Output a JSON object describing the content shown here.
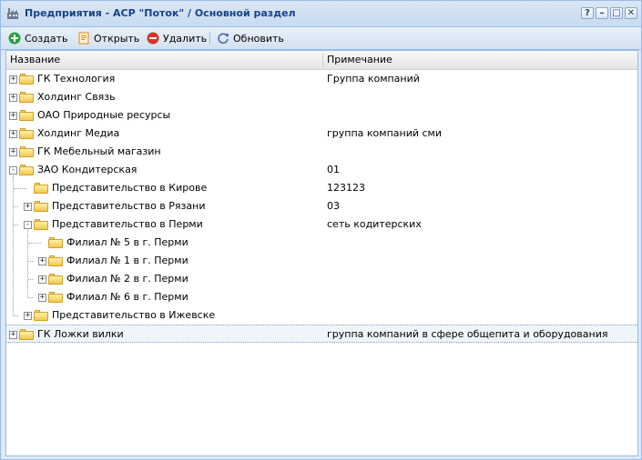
{
  "window": {
    "title": "Предприятия - АСР \"Поток\" / Основной раздел",
    "tools": {
      "help": "?",
      "minimize": "–",
      "maximize": "□",
      "close": "✕"
    }
  },
  "toolbar": {
    "create": "Создать",
    "open": "Открыть",
    "delete": "Удалить",
    "refresh": "Обновить"
  },
  "grid": {
    "columns": {
      "name": "Название",
      "note": "Примечание"
    },
    "rows": [
      {
        "name": "ГК Технология",
        "note": "Группа компаний",
        "level": 0,
        "expander": "+",
        "open": false
      },
      {
        "name": "Холдинг Связь",
        "note": "",
        "level": 0,
        "expander": "+",
        "open": false
      },
      {
        "name": "ОАО Природные ресурсы",
        "note": "",
        "level": 0,
        "expander": "+",
        "open": false
      },
      {
        "name": "Холдинг Медиа",
        "note": "группа компаний сми",
        "level": 0,
        "expander": "+",
        "open": false
      },
      {
        "name": "ГК Мебельный магазин",
        "note": "",
        "level": 0,
        "expander": "+",
        "open": false
      },
      {
        "name": "ЗАО Кондитерская",
        "note": "01",
        "level": 0,
        "expander": "-",
        "open": true
      },
      {
        "name": "Представительство в Кирове",
        "note": "123123",
        "level": 1,
        "expander": "",
        "open": false
      },
      {
        "name": "Представительство в Рязани",
        "note": "03",
        "level": 1,
        "expander": "+",
        "open": false
      },
      {
        "name": "Представительство в Перми",
        "note": "сеть кодитерских",
        "level": 1,
        "expander": "-",
        "open": true
      },
      {
        "name": "Филиал № 5 в г. Перми",
        "note": "",
        "level": 2,
        "expander": "",
        "open": false
      },
      {
        "name": "Филиал № 1 в г. Перми",
        "note": "",
        "level": 2,
        "expander": "+",
        "open": false
      },
      {
        "name": "Филиал № 2 в г. Перми",
        "note": "",
        "level": 2,
        "expander": "+",
        "open": false
      },
      {
        "name": "Филиал № 6 в г. Перми",
        "note": "",
        "level": 2,
        "expander": "+",
        "open": false
      },
      {
        "name": "Представительство в Ижевске",
        "note": "",
        "level": 1,
        "expander": "+",
        "open": false
      },
      {
        "name": "ГК Ложки вилки",
        "note": "группа компаний в сфере общепита и оборудования",
        "level": 0,
        "expander": "+",
        "open": false,
        "selected": true
      }
    ]
  },
  "colors": {
    "accent": "#15428b",
    "border": "#99bbe8",
    "toolbar": "#d3e1f1"
  }
}
